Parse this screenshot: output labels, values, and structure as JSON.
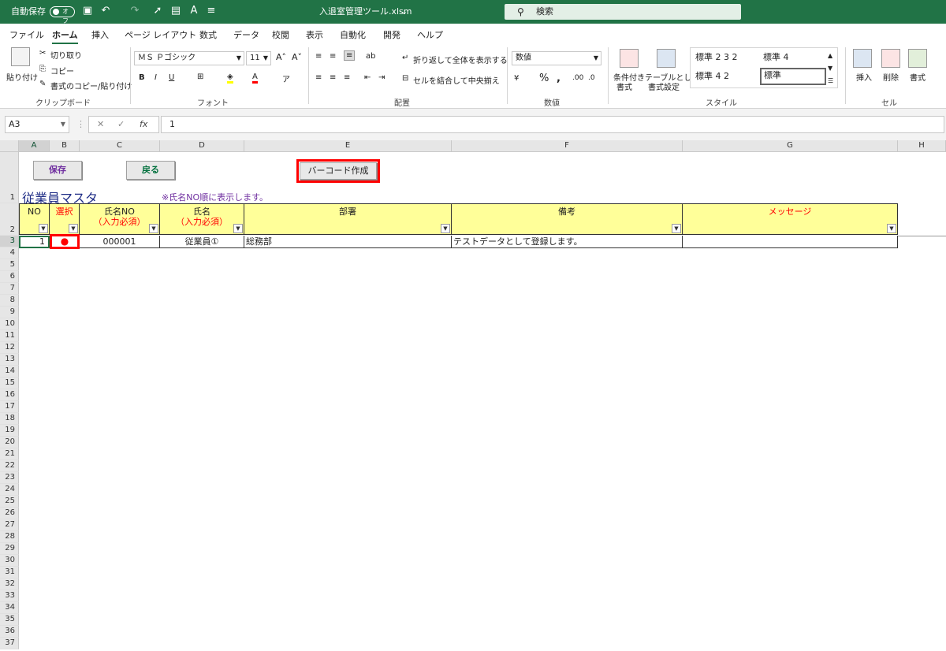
{
  "titlebar": {
    "autosave": "自動保存",
    "autosave_state": "オフ",
    "filename": "入退室管理ツール.xlsm",
    "search": "検索"
  },
  "menu": [
    "ファイル",
    "ホーム",
    "挿入",
    "ページ レイアウト",
    "数式",
    "データ",
    "校閲",
    "表示",
    "自動化",
    "開発",
    "ヘルプ"
  ],
  "ribbon": {
    "paste": "貼り付け",
    "cut": "切り取り",
    "copy": "コピー",
    "format_painter": "書式のコピー/貼り付け",
    "clipboard": "クリップボード",
    "font_name": "ＭＳ Ｐゴシック",
    "font_size": "11",
    "font": "フォント",
    "wrap_text": "折り返して全体を表示する",
    "merge_center": "セルを結合して中央揃え",
    "alignment": "配置",
    "number_format": "数値",
    "number": "数値",
    "conditional": "条件付き",
    "conditional2": "書式",
    "as_table": "テーブルとして",
    "as_table2": "書式設定",
    "style1": "標準 2 3 2",
    "style2": "標準 4",
    "style3": "標準 4 2",
    "style4": "標準",
    "styles": "スタイル",
    "insert": "挿入",
    "delete": "削除",
    "format": "書式",
    "cells": "セル"
  },
  "formula_bar": {
    "name_box": "A3",
    "content": "1"
  },
  "columns": [
    "A",
    "B",
    "C",
    "D",
    "E",
    "F",
    "G",
    "H"
  ],
  "rows": [
    "1",
    "2",
    "3",
    "4",
    "5",
    "6",
    "7",
    "8",
    "9",
    "10",
    "11",
    "12",
    "13",
    "14",
    "15",
    "16",
    "17",
    "18",
    "19",
    "20",
    "21",
    "22",
    "23",
    "24",
    "25",
    "26",
    "27",
    "28",
    "29",
    "30",
    "31",
    "32",
    "33",
    "34",
    "35",
    "36",
    "37"
  ],
  "sheet": {
    "save_button": "保存",
    "back_button": "戻る",
    "barcode_button": "バーコード作成",
    "title": "従業員マスタ",
    "note": "※氏名NO順に表示します。",
    "headers": {
      "no": "NO",
      "select": "選択",
      "name_no": "氏名NO",
      "name_no_sub": "（入力必須）",
      "name": "氏名",
      "name_sub": "（入力必須）",
      "dept": "部署",
      "remarks": "備考",
      "message": "メッセージ"
    },
    "row": {
      "no": "1",
      "select": "●",
      "name_no": "000001",
      "name": "従業員①",
      "dept": "総務部",
      "remarks": "テストデータとして登録します。",
      "message": ""
    }
  }
}
